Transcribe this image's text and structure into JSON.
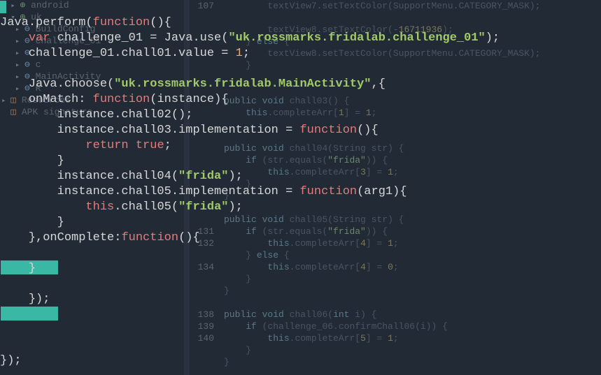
{
  "tree": {
    "items": [
      {
        "indent": 1,
        "expand": "▸",
        "icon": "⊖",
        "label": "android"
      },
      {
        "indent": 1,
        "expand": "▾",
        "icon": "⊕",
        "label": "uk"
      },
      {
        "indent": 2,
        "expand": "▸",
        "icon": "⊖",
        "label": "BuildConfig"
      },
      {
        "indent": 2,
        "expand": "▸",
        "icon": "⊖",
        "label": "challenge_01"
      },
      {
        "indent": 2,
        "expand": "▸",
        "icon": "⊖",
        "label": "c"
      },
      {
        "indent": 2,
        "expand": "▸",
        "icon": "⊖",
        "label": "c"
      },
      {
        "indent": 2,
        "expand": "▸",
        "icon": "⊖",
        "label": "MainActivity"
      },
      {
        "indent": 2,
        "expand": "▸",
        "icon": "⊖",
        "label": "R"
      }
    ],
    "resources_label": "Resources",
    "apk_label": "APK signature"
  },
  "decomp": {
    "lines": [
      {
        "ln": "107",
        "text": "        textView7.setTextColor(SupportMenu.CATEGORY_MASK);"
      },
      {
        "ln": "",
        "text": ""
      },
      {
        "ln": "",
        "text": "        textView8.setTextColor(-16711936);"
      },
      {
        "ln": "",
        "text": "    } else {"
      },
      {
        "ln": "",
        "text": "        textView8.setTextColor(SupportMenu.CATEGORY_MASK);"
      },
      {
        "ln": "",
        "text": "    }"
      },
      {
        "ln": "",
        "text": ""
      },
      {
        "ln": "",
        "text": ""
      },
      {
        "ln": "",
        "text": "public void chall03() {"
      },
      {
        "ln": "",
        "text": "    this.completeArr[1] = 1;"
      },
      {
        "ln": "",
        "text": ""
      },
      {
        "ln": "",
        "text": ""
      },
      {
        "ln": "",
        "text": "public void chall04(String str) {"
      },
      {
        "ln": "",
        "text": "    if (str.equals(\"frida\")) {"
      },
      {
        "ln": "",
        "text": "        this.completeArr[3] = 1;"
      },
      {
        "ln": "",
        "text": "    }"
      },
      {
        "ln": "",
        "text": "}"
      },
      {
        "ln": "",
        "text": ""
      },
      {
        "ln": "",
        "text": "public void chall05(String str) {"
      },
      {
        "ln": "131",
        "text": "    if (str.equals(\"frida\")) {"
      },
      {
        "ln": "132",
        "text": "        this.completeArr[4] = 1;"
      },
      {
        "ln": "",
        "text": "    } else {"
      },
      {
        "ln": "134",
        "text": "        this.completeArr[4] = 0;"
      },
      {
        "ln": "",
        "text": "    }"
      },
      {
        "ln": "",
        "text": "}"
      },
      {
        "ln": "",
        "text": ""
      },
      {
        "ln": "138",
        "text": "public void chall06(int i) {"
      },
      {
        "ln": "139",
        "text": "    if (challenge_06.confirmChall06(i)) {"
      },
      {
        "ln": "140",
        "text": "        this.completeArr[5] = 1;"
      },
      {
        "ln": "",
        "text": "    }"
      },
      {
        "ln": "",
        "text": "}"
      }
    ]
  },
  "fg": {
    "t": {
      "Java": "Java",
      "perform": ".perform(",
      "function": "function",
      "paren_brace": "(){",
      "var": "var",
      "challenge_01_eq": " challenge_01 = Java.use(",
      "str_chal01": "\"uk.rossmarks.fridalab.challenge_01\"",
      "close_paren_semi": ");",
      "challenge_01_chall01_value": "    challenge_01.chall01.value = ",
      "one": "1",
      "semi": ";",
      "Java_choose": "    Java.choose(",
      "str_main": "\"uk.rossmarks.fridalab.MainActivity\"",
      "comma_brace": ",{",
      "onMatch": "    onMatch: ",
      "instance_brace": "(instance){",
      "instance_chall02": "        instance.chall02();",
      "instance_chall03_impl": "        instance.chall03.implementation = ",
      "return": "return",
      "true": "true",
      "close_brace": "        }",
      "instance_chall04": "        instance.chall04(",
      "str_frida": "\"frida\"",
      "instance_chall05_impl": "        instance.chall05.implementation = ",
      "arg1_brace": "(arg1){",
      "this": "this",
      "dot_chall05": ".chall05(",
      "onComplete": "    },onComplete:",
      "close_brace2": "    }",
      "close_brace3": "});",
      "close_brace4": "});"
    }
  }
}
